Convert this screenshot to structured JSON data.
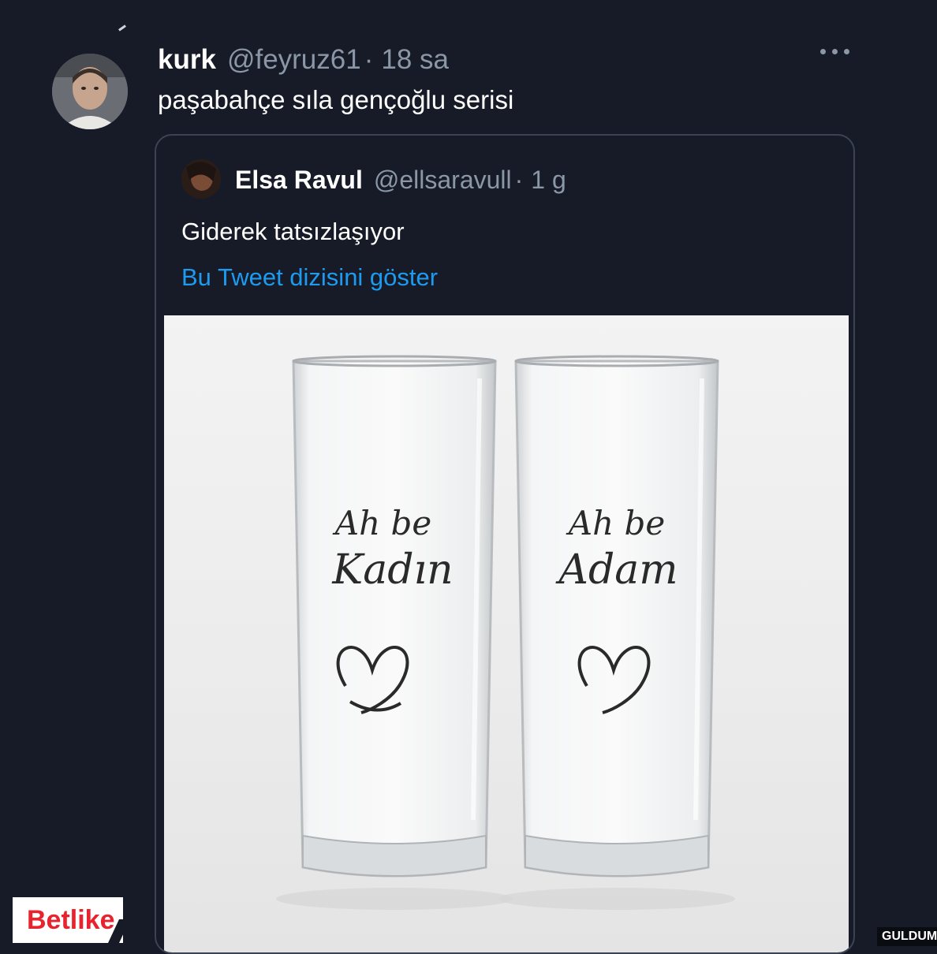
{
  "tweet": {
    "author_name": "kurk",
    "author_handle": "@feyruz61",
    "separator": "·",
    "time": "18 sa",
    "text": "paşabahçe sıla gençoğlu serisi",
    "more_icon": "more-horizontal-icon"
  },
  "quoted": {
    "author_name": "Elsa Ravul",
    "author_handle": "@ellsaravull",
    "separator": "·",
    "time": "1 g",
    "text": "Giderek tatsızlaşıyor",
    "show_thread": "Bu Tweet dizisini göster",
    "media": {
      "left_glass": {
        "line1": "Ah be",
        "line2": "Kadın"
      },
      "right_glass": {
        "line1": "Ah be",
        "line2": "Adam"
      }
    }
  },
  "brand_logo": "Betlike",
  "watermark": "GULDUM.NET",
  "colors": {
    "background": "#161b27",
    "link": "#1d9bf0",
    "secondary_text": "#8b97a6",
    "brand_red": "#e8232e"
  }
}
